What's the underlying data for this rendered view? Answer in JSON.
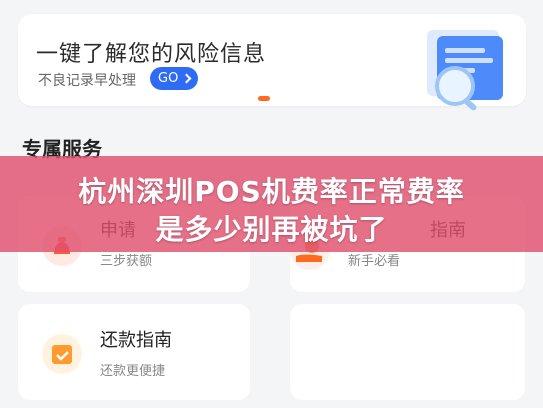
{
  "risk_card": {
    "title": "一键了解您的风险信息",
    "subtitle": "不良记录早处理",
    "go_label": "GO"
  },
  "section": {
    "title": "专属服务"
  },
  "services": [
    {
      "name": "申请",
      "desc": "三步获额",
      "icon": "money-bag-icon"
    },
    {
      "name": "指南",
      "desc": "新手必看",
      "icon": "hand-coin-icon"
    },
    {
      "name": "还款指南",
      "desc": "还款更便捷",
      "icon": "calendar-check-icon"
    }
  ],
  "banner": {
    "line1": "杭州深圳POS机费率正常费率",
    "line2": "是多少别再被坑了"
  },
  "colors": {
    "accent": "#2e6cf6",
    "banner": "#e1506e",
    "dot_active": "#ff6a21"
  }
}
